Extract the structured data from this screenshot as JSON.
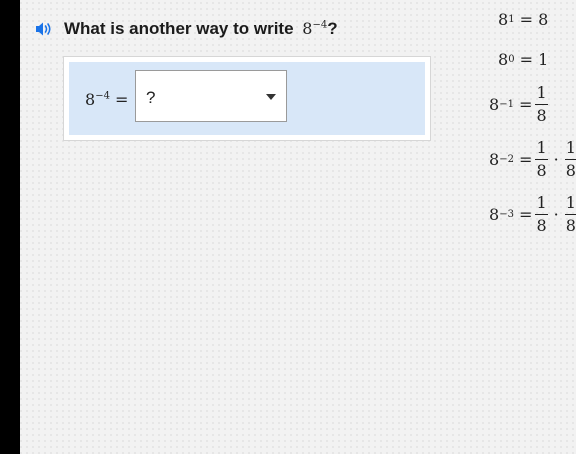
{
  "question": {
    "prefix": "What is another way to write",
    "base": "8",
    "exponent": "−4",
    "suffix": "?",
    "speaker_icon": "speaker-icon",
    "accent_color": "#1a73e8"
  },
  "answer": {
    "lhs_base": "8",
    "lhs_exponent": "−4",
    "equals": "=",
    "selected_value": "?",
    "caret_icon": "caret-down-icon"
  },
  "reference": [
    {
      "base": "8",
      "exp": "1",
      "rhs": "= 8"
    },
    {
      "base": "8",
      "exp": "0",
      "rhs": "= 1"
    },
    {
      "base": "8",
      "exp": "−1",
      "eq": "=",
      "num": "1",
      "den": "8"
    },
    {
      "base": "8",
      "exp": "−2",
      "eq": "=",
      "num": "1",
      "den": "8",
      "dot": "·",
      "num2": "1",
      "den2": "8"
    },
    {
      "base": "8",
      "exp": "−3",
      "eq": "=",
      "num": "1",
      "den": "8",
      "dot": "·",
      "num2": "1",
      "den2": "8"
    }
  ]
}
